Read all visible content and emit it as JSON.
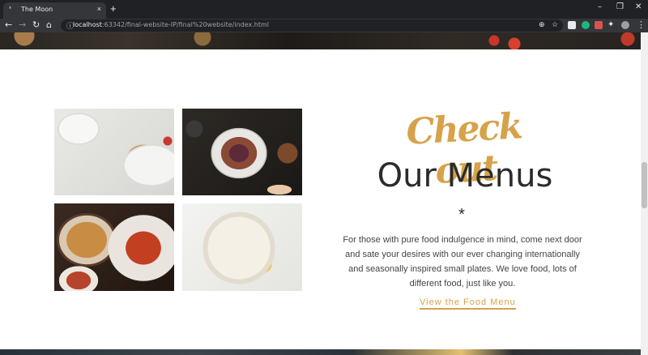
{
  "browser": {
    "tab_title": "The Moon",
    "tab_close": "×",
    "new_tab": "+",
    "url_host": "localhost",
    "url_path": ":63342/final-website-IP/final%20website/index.html",
    "window_controls": {
      "minimize": "–",
      "restore": "❐",
      "close": "✕"
    }
  },
  "section": {
    "heading_script": "Check out",
    "heading_main": "Our Menus",
    "divider": "*",
    "description": "For those with pure food indulgence in mind, come next door and sate your desires with our ever changing internationally and seasonally inspired small plates. We love food, lots of different food, just like you.",
    "cta_label": "View the Food Menu"
  },
  "colors": {
    "accent": "#d6a24a",
    "heading": "#2b2b2b",
    "body_text": "#444444",
    "chrome_dark": "#202124",
    "chrome_toolbar": "#35363a"
  },
  "icons": [
    "back-arrow-icon",
    "forward-arrow-icon",
    "reload-icon",
    "home-icon",
    "lock-icon",
    "zoom-icon",
    "star-icon",
    "extensions-icon",
    "profile-avatar",
    "menu-dots-icon"
  ]
}
